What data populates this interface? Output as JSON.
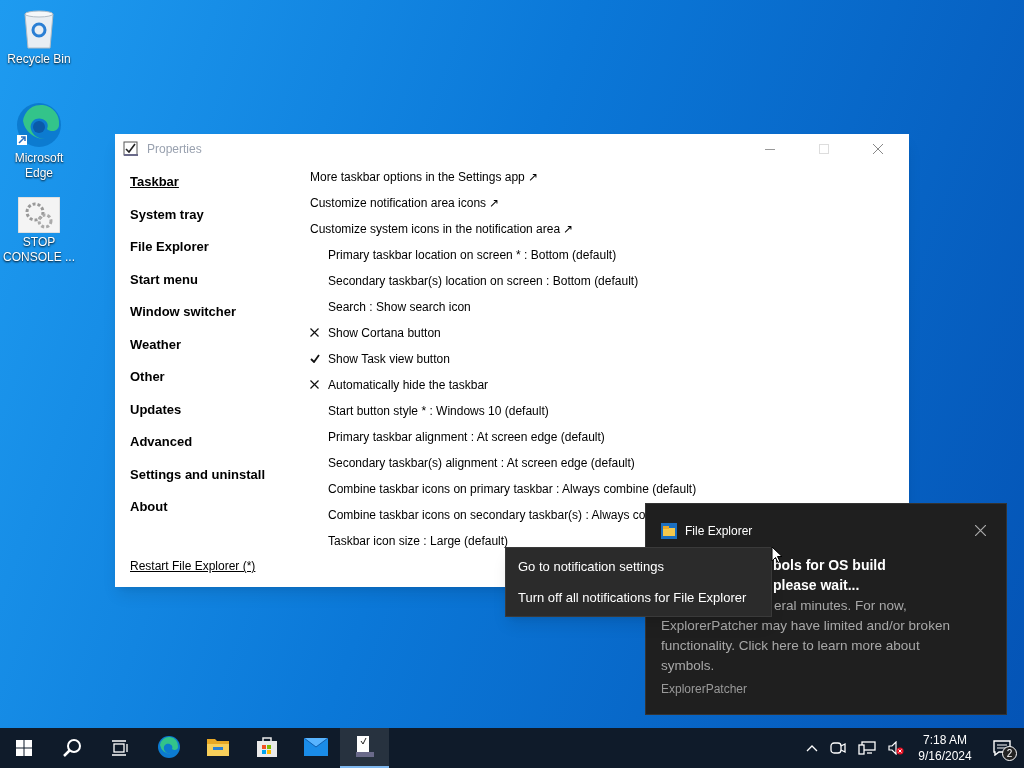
{
  "desktop_icons": [
    {
      "label": "Recycle Bin",
      "kind": "bin"
    },
    {
      "label": "Microsoft Edge",
      "kind": "edge"
    },
    {
      "label": "STOP CONSOLE ...",
      "kind": "gears"
    }
  ],
  "window": {
    "title": "Properties",
    "sidebar": {
      "items": [
        {
          "label": "Taskbar",
          "selected": true
        },
        {
          "label": "System tray",
          "selected": false
        },
        {
          "label": "File Explorer",
          "selected": false
        },
        {
          "label": "Start menu",
          "selected": false
        },
        {
          "label": "Window switcher",
          "selected": false
        },
        {
          "label": "Weather",
          "selected": false
        },
        {
          "label": "Other",
          "selected": false
        },
        {
          "label": "Updates",
          "selected": false
        },
        {
          "label": "Advanced",
          "selected": false
        },
        {
          "label": "Settings and uninstall",
          "selected": false
        },
        {
          "label": "About",
          "selected": false
        }
      ],
      "footer_link": "Restart File Explorer (*)"
    },
    "settings": [
      {
        "kind": "link",
        "label": "More taskbar options in the Settings app ↗"
      },
      {
        "kind": "link",
        "label": "Customize notification area icons ↗"
      },
      {
        "kind": "link",
        "label": "Customize system icons in the notification area ↗"
      },
      {
        "kind": "choice",
        "label": "Primary taskbar location on screen * : Bottom (default)"
      },
      {
        "kind": "choice",
        "label": "Secondary taskbar(s) location on screen : Bottom (default)"
      },
      {
        "kind": "choice",
        "label": "Search : Show search icon"
      },
      {
        "kind": "toggle",
        "label": "Show Cortana button",
        "checked": false
      },
      {
        "kind": "toggle",
        "label": "Show Task view button",
        "checked": true
      },
      {
        "kind": "toggle",
        "label": "Automatically hide the taskbar",
        "checked": false
      },
      {
        "kind": "choice",
        "label": "Start button style * : Windows 10 (default)"
      },
      {
        "kind": "choice",
        "label": "Primary taskbar alignment : At screen edge (default)"
      },
      {
        "kind": "choice",
        "label": "Secondary taskbar(s) alignment : At screen edge (default)"
      },
      {
        "kind": "choice",
        "label": "Combine taskbar icons on primary taskbar : Always combine (default)"
      },
      {
        "kind": "choice",
        "label": "Combine taskbar icons on secondary taskbar(s) : Always co"
      },
      {
        "kind": "choice",
        "label": "Taskbar icon size : Large (default)"
      }
    ]
  },
  "toast": {
    "app": "File Explorer",
    "title_lines": [
      "bols for OS build",
      "please wait..."
    ],
    "body_lines": [
      "eral minutes. For now,",
      "ExplorerPatcher may have limited and/or broken",
      "functionality. Click here to learn more about",
      "symbols."
    ],
    "source": "ExplorerPatcher"
  },
  "context_menu": [
    "Go to notification settings",
    "Turn off all notifications for File Explorer"
  ],
  "taskbar": {
    "apps": [
      {
        "kind": "edge",
        "active": false
      },
      {
        "kind": "folder",
        "active": false
      },
      {
        "kind": "store",
        "active": false
      },
      {
        "kind": "mail",
        "active": false
      },
      {
        "kind": "patcher",
        "active": true
      }
    ],
    "time": "7:18 AM",
    "date": "9/16/2024",
    "notification_count": "2"
  }
}
